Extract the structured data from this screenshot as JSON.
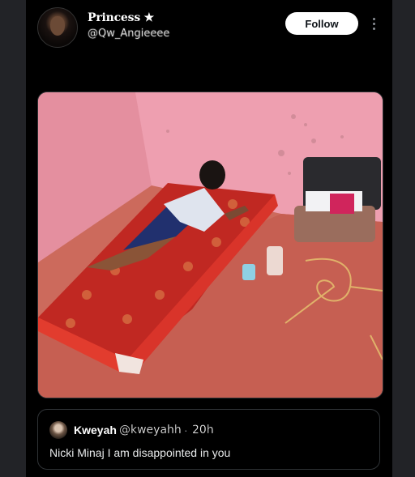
{
  "post": {
    "author_name": "Princess ★",
    "author_handle": "@Qw_Angieeee",
    "follow_label": "Follow",
    "more_icon": "more-vertical-icon"
  },
  "media": {
    "alt": "",
    "colors": {
      "wall": "#e89aa8",
      "floor": "#c9665a",
      "mattress": "#c22a22"
    }
  },
  "quoted_post": {
    "author_name": "Kweyah",
    "author_handle": "@kweyahh",
    "separator": "·",
    "time": "20h",
    "text": "Nicki Minaj I am disappointed in you"
  },
  "colors": {
    "background": "#000000",
    "follow_button_bg": "#ffffff",
    "border": "#2f3336",
    "muted": "#8b8f95"
  }
}
